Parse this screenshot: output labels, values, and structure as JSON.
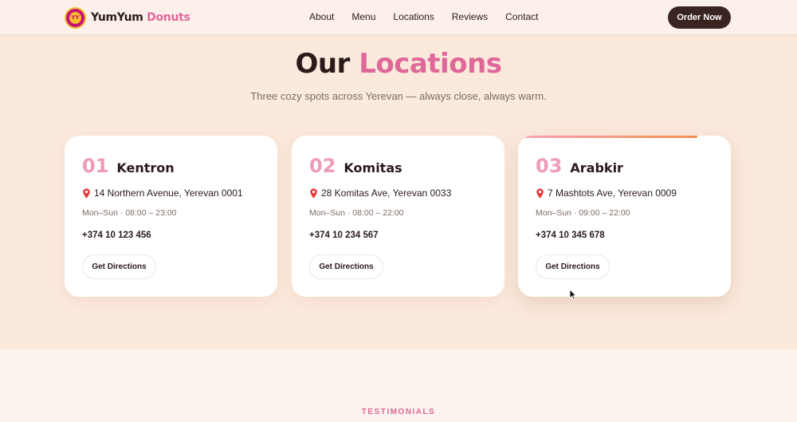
{
  "brand": {
    "name_main": "YumYum",
    "name_accent": "Donuts",
    "logo_text": "YY"
  },
  "nav": {
    "items": [
      "About",
      "Menu",
      "Locations",
      "Reviews",
      "Contact"
    ]
  },
  "header": {
    "cta_label": "Order Now"
  },
  "section": {
    "title_main": "Our",
    "title_accent": "Locations",
    "subtitle": "Three cozy spots across Yerevan — always close, always warm."
  },
  "locations": [
    {
      "number": "01",
      "name": "Kentron",
      "address": "14 Northern Avenue, Yerevan 0001",
      "hours": "Mon–Sun · 08:00 – 23:00",
      "phone": "+374 10 123 456",
      "button": "Get Directions"
    },
    {
      "number": "02",
      "name": "Komitas",
      "address": "28 Komitas Ave, Yerevan 0033",
      "hours": "Mon–Sun · 08:00 – 22:00",
      "phone": "+374 10 234 567",
      "button": "Get Directions"
    },
    {
      "number": "03",
      "name": "Arabkir",
      "address": "7 Mashtots Ave, Yerevan 0009",
      "hours": "Mon–Sun · 09:00 – 22:00",
      "phone": "+374 10 345 678",
      "button": "Get Directions"
    }
  ],
  "testimonials": {
    "eyebrow": "TESTIMONIALS"
  },
  "colors": {
    "accent": "#e0679a",
    "dark": "#3a2422",
    "background": "#fbe9dc"
  },
  "icons": {
    "pin": "map-pin-icon",
    "cursor": "mouse-cursor-icon"
  }
}
